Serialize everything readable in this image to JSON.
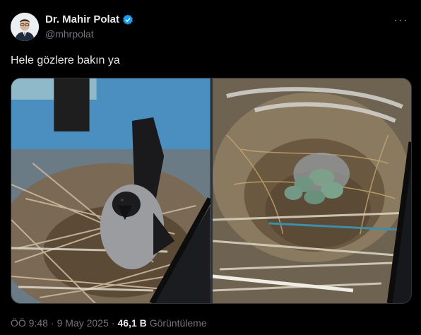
{
  "author": {
    "display_name": "Dr. Mahir Polat",
    "handle": "@mhrpolat",
    "verified": true
  },
  "more_label": "···",
  "tweet_text": "Hele gözlere bakın ya",
  "media": [
    {
      "icon": "crow-on-nest-photo"
    },
    {
      "icon": "nest-with-eggs-photo"
    }
  ],
  "meta": {
    "time": "ÖÖ 9:48",
    "separator": "·",
    "date": "9 May 2025",
    "views_separator": "·",
    "views_count": "46,1 B",
    "views_label": "Görüntüleme"
  },
  "colors": {
    "background": "#000000",
    "text": "#e7e9ea",
    "muted": "#71767b",
    "verified": "#1d9bf0"
  }
}
